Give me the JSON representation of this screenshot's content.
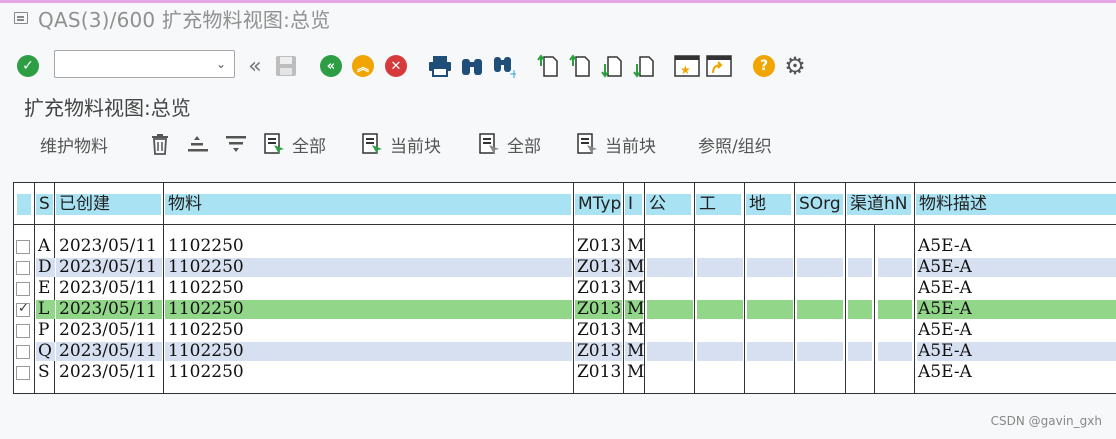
{
  "window": {
    "title": "QAS(3)/600 扩充物料视图:总览"
  },
  "toolbar": {
    "command_value": "",
    "colors": {
      "green": "#2e9e44",
      "orange": "#f0a500",
      "red": "#d63a3a",
      "blue_dark": "#1f4e79"
    }
  },
  "page": {
    "subtitle": "扩充物料视图:总览"
  },
  "app_toolbar": {
    "maintain_material": "维护物料",
    "select_all": "全部",
    "select_block": "当前块",
    "deselect_all": "全部",
    "deselect_block": "当前块",
    "reference_org": "参照/组织"
  },
  "table": {
    "headers": {
      "s": "S",
      "created": "已创建",
      "material": "物料",
      "mtyp": "MTyp",
      "i": "I",
      "company": "公",
      "plant": "工",
      "location": "地",
      "sorg": "SOrg",
      "channel": "渠道hN",
      "description": "物料描述"
    },
    "rows": [
      {
        "sel": false,
        "s": "A",
        "created": "2023/05/11",
        "material": "1102250",
        "mtyp": "Z013",
        "i": "M",
        "description": "A5E-A",
        "highlight": "none"
      },
      {
        "sel": false,
        "s": "D",
        "created": "2023/05/11",
        "material": "1102250",
        "mtyp": "Z013",
        "i": "M",
        "description": "A5E-A",
        "highlight": "blue"
      },
      {
        "sel": false,
        "s": "E",
        "created": "2023/05/11",
        "material": "1102250",
        "mtyp": "Z013",
        "i": "M",
        "description": "A5E-A",
        "highlight": "none"
      },
      {
        "sel": true,
        "s": "L",
        "created": "2023/05/11",
        "material": "1102250",
        "mtyp": "Z013",
        "i": "M",
        "description": "A5E-A",
        "highlight": "green"
      },
      {
        "sel": false,
        "s": "P",
        "created": "2023/05/11",
        "material": "1102250",
        "mtyp": "Z013",
        "i": "M",
        "description": "A5E-A",
        "highlight": "none"
      },
      {
        "sel": false,
        "s": "Q",
        "created": "2023/05/11",
        "material": "1102250",
        "mtyp": "Z013",
        "i": "M",
        "description": "A5E-A",
        "highlight": "blue"
      },
      {
        "sel": false,
        "s": "S",
        "created": "2023/05/11",
        "material": "1102250",
        "mtyp": "Z013",
        "i": "M",
        "description": "A5E-A",
        "highlight": "none"
      }
    ],
    "colors": {
      "header": "#a9e2f3",
      "blue_band": "#d6e0f0",
      "green_band": "#92d68a"
    }
  },
  "watermark": "CSDN @gavin_gxh"
}
